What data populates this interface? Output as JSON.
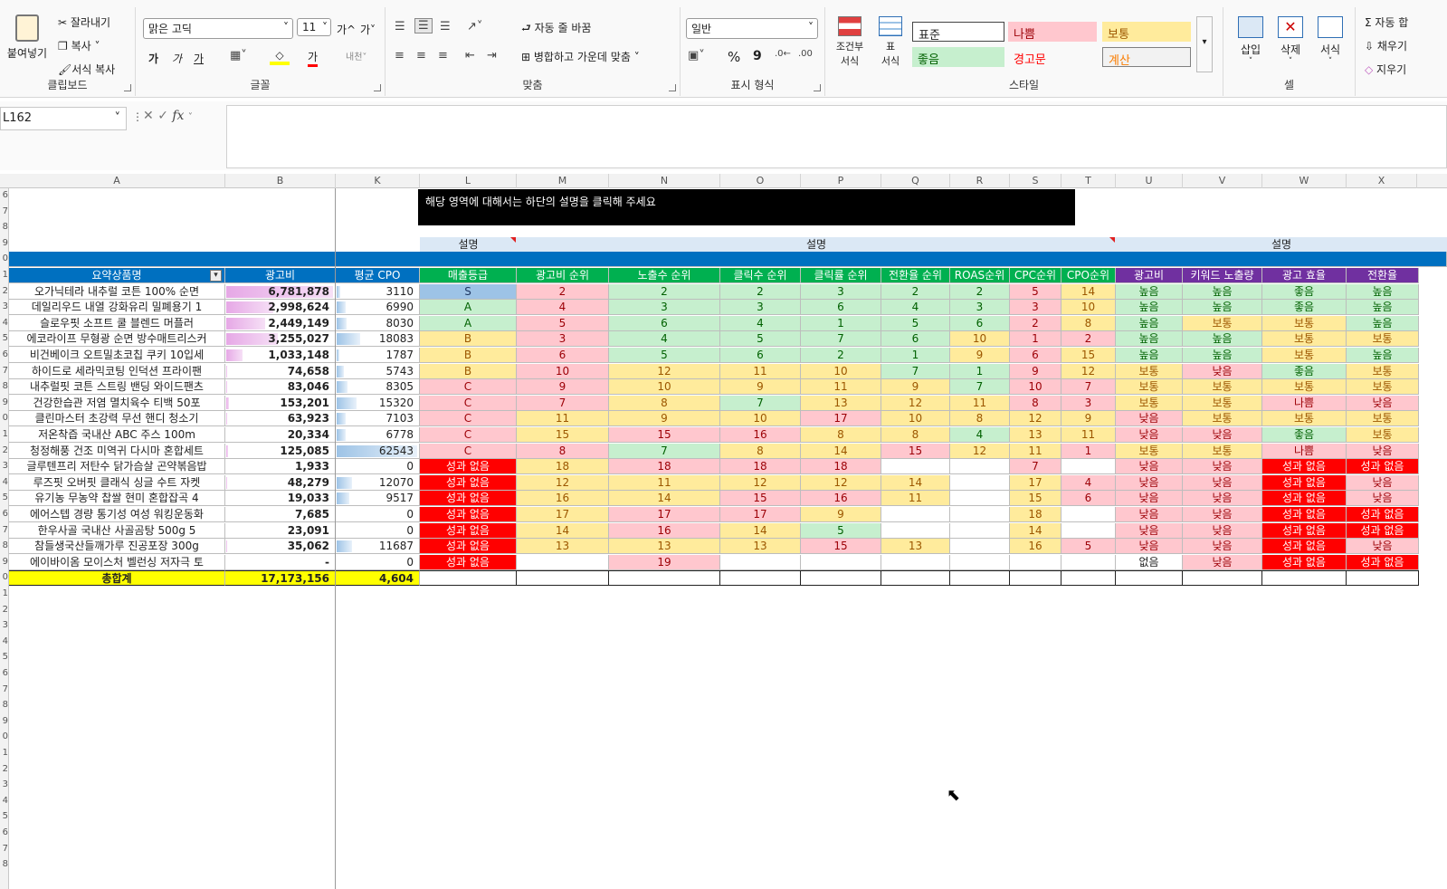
{
  "ribbon": {
    "clipboard": {
      "paste": "붙여넣기",
      "cut": "잘라내기",
      "copy": "복사",
      "format_painter": "서식 복사",
      "label": "클립보드"
    },
    "font": {
      "name": "맑은 고딕",
      "size": "11",
      "grow": "가^",
      "shrink": "가˅",
      "bold": "가",
      "italic": "가",
      "underline": "가",
      "label": "글꼴"
    },
    "alignment": {
      "wrap_text": "자동 줄 바꿈",
      "merge_center": "병합하고 가운데 맞춤",
      "label": "맞춤"
    },
    "number": {
      "format": "일반",
      "percent": "%",
      "comma": "9",
      "label": "표시 형식"
    },
    "styles": {
      "conditional": "조건부\n서식",
      "table": "표\n서식",
      "normal": "표준",
      "bad": "나쁨",
      "neutral": "보통",
      "good": "좋음",
      "warning": "경고문",
      "calc": "계산",
      "label": "스타일"
    },
    "cells": {
      "insert": "삽입",
      "delete": "삭제",
      "format": "서식",
      "label": "셀"
    },
    "editing": {
      "autosum": "자동 합",
      "fill": "채우기",
      "clear": "지우기"
    }
  },
  "formula_bar": {
    "name_box": "L162",
    "fx": "fx",
    "formula": ""
  },
  "columns": [
    "A",
    "B",
    "K",
    "L",
    "M",
    "N",
    "O",
    "P",
    "Q",
    "R",
    "S",
    "T",
    "U",
    "V",
    "W",
    "X"
  ],
  "row_numbers": [
    "6",
    "7",
    "8",
    "9",
    "0",
    "1",
    "2",
    "3",
    "4",
    "5",
    "6",
    "7",
    "8",
    "9",
    "0",
    "1",
    "2",
    "3",
    "4",
    "5",
    "6",
    "7",
    "8",
    "9",
    "0",
    "1",
    "2",
    "3",
    "4",
    "5",
    "6",
    "7",
    "8",
    "9",
    "0",
    "1",
    "2",
    "3",
    "4",
    "5",
    "6",
    "7",
    "8"
  ],
  "banner": "해당 영역에 대해서는 하단의 설명을 클릭해 주세요",
  "description_labels": {
    "l": "설명",
    "m_t": "설명",
    "u_x": "설명"
  },
  "headers": [
    "요약상품명",
    "광고비",
    "평균 CPO",
    "매출등급",
    "광고비 순위",
    "노출수 순위",
    "클릭수 순위",
    "클릭률 순위",
    "전환율 순위",
    "ROAS순위",
    "CPC순위",
    "CPO순위",
    "광고비",
    "키워드 노출량",
    "광고 효율",
    "전환율"
  ],
  "rows": [
    [
      "오가닉테라 내추럴 코튼 100% 순면",
      "6,781,878",
      "3110",
      "S",
      "2",
      "2",
      "2",
      "3",
      "2",
      "2",
      "5",
      "14",
      "높음",
      "높음",
      "좋음",
      "높음"
    ],
    [
      "데일리우드 내열 강화유리 밀폐용기 1",
      "2,998,624",
      "6990",
      "A",
      "4",
      "3",
      "3",
      "6",
      "4",
      "3",
      "3",
      "10",
      "높음",
      "높음",
      "좋음",
      "높음"
    ],
    [
      "슬로우핏 소프트 쿨 블렌드 머플러",
      "2,449,149",
      "8030",
      "A",
      "5",
      "6",
      "4",
      "1",
      "5",
      "6",
      "2",
      "8",
      "높음",
      "보통",
      "보통",
      "높음"
    ],
    [
      "에코라이프 무형광 순면 방수매트리스커",
      "3,255,027",
      "18083",
      "B",
      "3",
      "4",
      "5",
      "7",
      "6",
      "10",
      "1",
      "2",
      "높음",
      "높음",
      "보통",
      "보통"
    ],
    [
      "비건베이크 오트밀초코칩 쿠키 10입세",
      "1,033,148",
      "1787",
      "B",
      "6",
      "5",
      "6",
      "2",
      "1",
      "9",
      "6",
      "15",
      "높음",
      "높음",
      "보통",
      "높음"
    ],
    [
      "하이드로 세라믹코팅 인덕션 프라이팬",
      "74,658",
      "5743",
      "B",
      "10",
      "12",
      "11",
      "10",
      "7",
      "1",
      "9",
      "12",
      "보통",
      "낮음",
      "좋음",
      "보통"
    ],
    [
      "내추럴핏 코튼 스트링 밴딩 와이드팬츠",
      "83,046",
      "8305",
      "C",
      "9",
      "10",
      "9",
      "11",
      "9",
      "7",
      "10",
      "7",
      "보통",
      "보통",
      "보통",
      "보통"
    ],
    [
      "건강한습관 저염 멸치육수 티백 50포",
      "153,201",
      "15320",
      "C",
      "7",
      "8",
      "7",
      "13",
      "12",
      "11",
      "8",
      "3",
      "보통",
      "보통",
      "나쁨",
      "낮음"
    ],
    [
      "클린마스터 초강력 무선 핸디 청소기",
      "63,923",
      "7103",
      "C",
      "11",
      "9",
      "10",
      "17",
      "10",
      "8",
      "12",
      "9",
      "낮음",
      "보통",
      "보통",
      "보통"
    ],
    [
      "저온착즙 국내산 ABC 주스 100m",
      "20,334",
      "6778",
      "C",
      "15",
      "15",
      "16",
      "8",
      "8",
      "4",
      "13",
      "11",
      "낮음",
      "낮음",
      "좋음",
      "보통"
    ],
    [
      "청정해풍 건조 미역귀 다시마 혼합세트",
      "125,085",
      "62543",
      "C",
      "8",
      "7",
      "8",
      "14",
      "15",
      "12",
      "11",
      "1",
      "보통",
      "보통",
      "나쁨",
      "낮음"
    ],
    [
      "글루텐프리 저탄수 닭가슴살 곤약볶음밥",
      "1,933",
      "0",
      "성과 없음",
      "18",
      "18",
      "18",
      "18",
      "",
      "",
      "7",
      "",
      "낮음",
      "낮음",
      "성과 없음",
      "성과 없음"
    ],
    [
      "루즈핏 오버핏 클래식 싱글 수트 자켓",
      "48,279",
      "12070",
      "성과 없음",
      "12",
      "11",
      "12",
      "12",
      "14",
      "",
      "17",
      "4",
      "낮음",
      "낮음",
      "성과 없음",
      "낮음"
    ],
    [
      "유기농 무농약 찹쌀 현미 혼합잡곡 4",
      "19,033",
      "9517",
      "성과 없음",
      "16",
      "14",
      "15",
      "16",
      "11",
      "",
      "15",
      "6",
      "낮음",
      "낮음",
      "성과 없음",
      "낮음"
    ],
    [
      "에어스텝 경량 통기성 여성 워킹운동화",
      "7,685",
      "0",
      "성과 없음",
      "17",
      "17",
      "17",
      "9",
      "",
      "",
      "18",
      "",
      "낮음",
      "낮음",
      "성과 없음",
      "성과 없음"
    ],
    [
      "한우사골 국내산 사골곰탕 500g 5",
      "23,091",
      "0",
      "성과 없음",
      "14",
      "16",
      "14",
      "5",
      "",
      "",
      "14",
      "",
      "낮음",
      "낮음",
      "성과 없음",
      "성과 없음"
    ],
    [
      "참들생국산들깨가루 진공포장 300g",
      "35,062",
      "11687",
      "성과 없음",
      "13",
      "13",
      "13",
      "15",
      "13",
      "",
      "16",
      "5",
      "낮음",
      "낮음",
      "성과 없음",
      "낮음"
    ],
    [
      "에이바이옴 모이스처 벨런싱 저자극 토",
      "-",
      "0",
      "성과 없음",
      "",
      "19",
      "",
      "",
      "",
      "",
      "",
      "",
      "없음",
      "낮음",
      "성과 없음",
      "성과 없음"
    ]
  ],
  "totals": {
    "label": "총합계",
    "ad_cost": "17,173,156",
    "avg_cpo": "4,604"
  },
  "colors": {
    "header_blue": "#0070c0",
    "header_green": "#00b050",
    "header_purple": "#7030a0",
    "good": "#c6efce",
    "neutral": "#ffeb9c",
    "bad": "#ffc7ce",
    "red": "#ff0000",
    "total_yellow": "#ffff00",
    "grade_s": "#9dc3e6"
  }
}
